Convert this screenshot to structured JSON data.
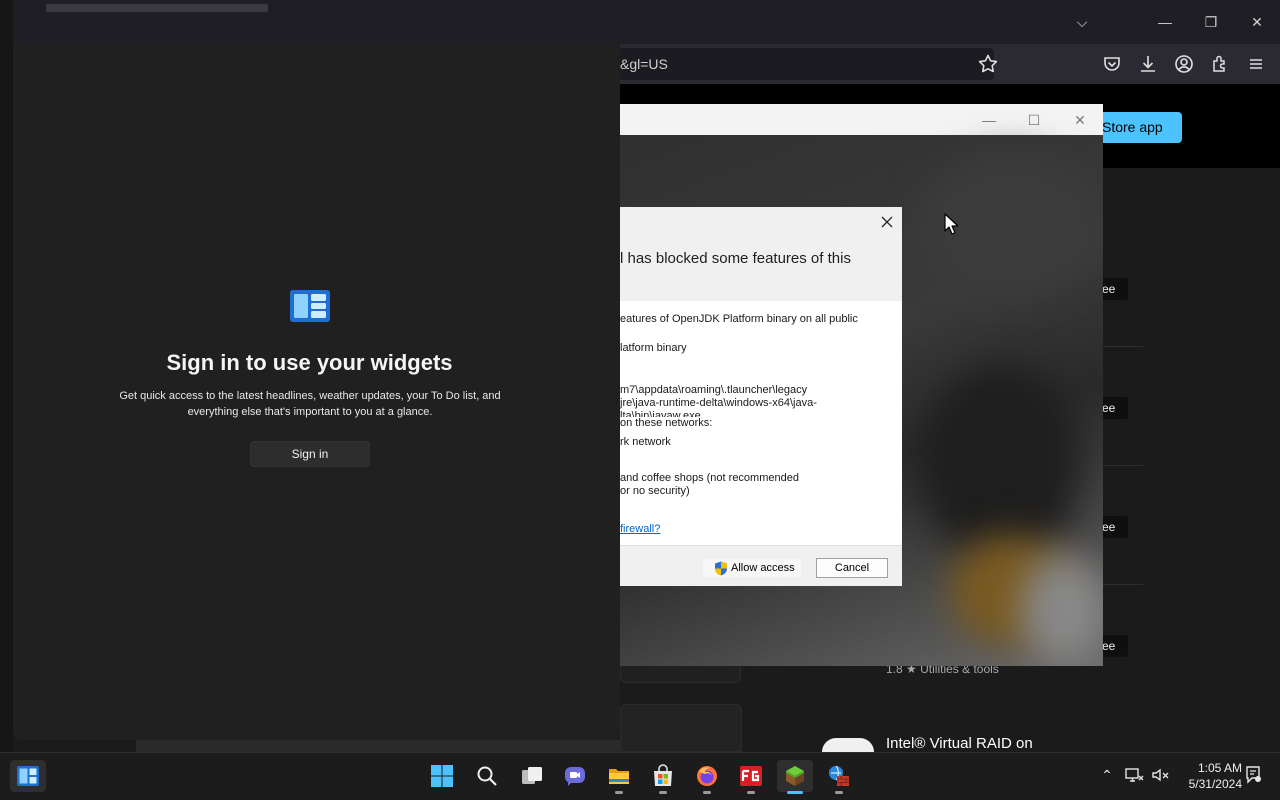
{
  "browser": {
    "url_fragment": "&gl=US",
    "window_controls": {
      "list_tabs": "⌵",
      "minimize": "—",
      "restore": "❐",
      "close": "✕"
    }
  },
  "store": {
    "open_app_button": "Store app",
    "free_badges": [
      "ree",
      "ree",
      "ree",
      "ree"
    ],
    "rating_text": "1.8 ★  Utilities & tools",
    "app_title": "Intel® Virtual RAID on"
  },
  "app_window": {
    "controls": {
      "minimize": "—",
      "maximize": "☐",
      "close": "✕"
    }
  },
  "firewall_dialog": {
    "heading": "l has blocked some features of this",
    "lines": [
      "eatures of OpenJDK Platform binary on all public",
      "latform binary",
      "m7\\appdata\\roaming\\.tlauncher\\legacy",
      "jre\\java-runtime-delta\\windows-x64\\java-",
      "lta\\bin\\javaw.exe",
      "on these networks:",
      "rk network",
      "and coffee shops (not recommended",
      "or no security)"
    ],
    "link": "firewall?",
    "allow_button": "Allow access",
    "cancel_button": "Cancel"
  },
  "widgets": {
    "title": "Sign in to use your widgets",
    "description": "Get quick access to the latest headlines, weather updates, your To Do list, and everything else that's important to you at a glance.",
    "signin_button": "Sign in"
  },
  "taskbar": {
    "time": "1:05 AM",
    "date": "5/31/2024",
    "tray_chevron": "⌃",
    "accent": "#4cc2ff"
  }
}
